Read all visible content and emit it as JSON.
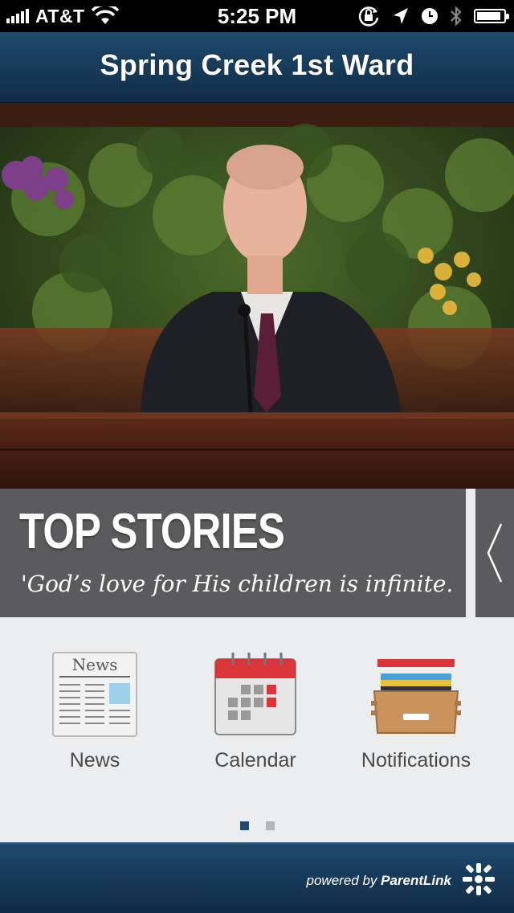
{
  "status_bar": {
    "carrier": "AT&T",
    "time": "5:25 PM",
    "icons": [
      "signal-icon",
      "wifi-icon",
      "orientation-lock-icon",
      "location-icon",
      "alarm-icon",
      "bluetooth-icon",
      "battery-icon"
    ],
    "battery_level": 0.9
  },
  "header": {
    "title": "Spring Creek 1st Ward"
  },
  "top_stories": {
    "heading": "TOP STORIES",
    "quote": "'God’s love for His children is infinite....",
    "arrow_icon": "chevron-left-icon"
  },
  "launcher": {
    "items": [
      {
        "label": "News",
        "icon": "newspaper-icon",
        "icon_text": "News"
      },
      {
        "label": "Calendar",
        "icon": "calendar-icon"
      },
      {
        "label": "Notifications",
        "icon": "file-box-icon"
      }
    ],
    "page_count": 2,
    "current_page": 1
  },
  "footer": {
    "powered_prefix": "powered by",
    "brand": "ParentLink",
    "logo_icon": "parentlink-logo-icon"
  },
  "colors": {
    "nav_blue": "#1f4a6e",
    "overlay_gray": "#5b5b5d",
    "launcher_bg": "#ecedef",
    "dot_active": "#1f4a6e",
    "dot_inactive": "#b5b6b8"
  }
}
